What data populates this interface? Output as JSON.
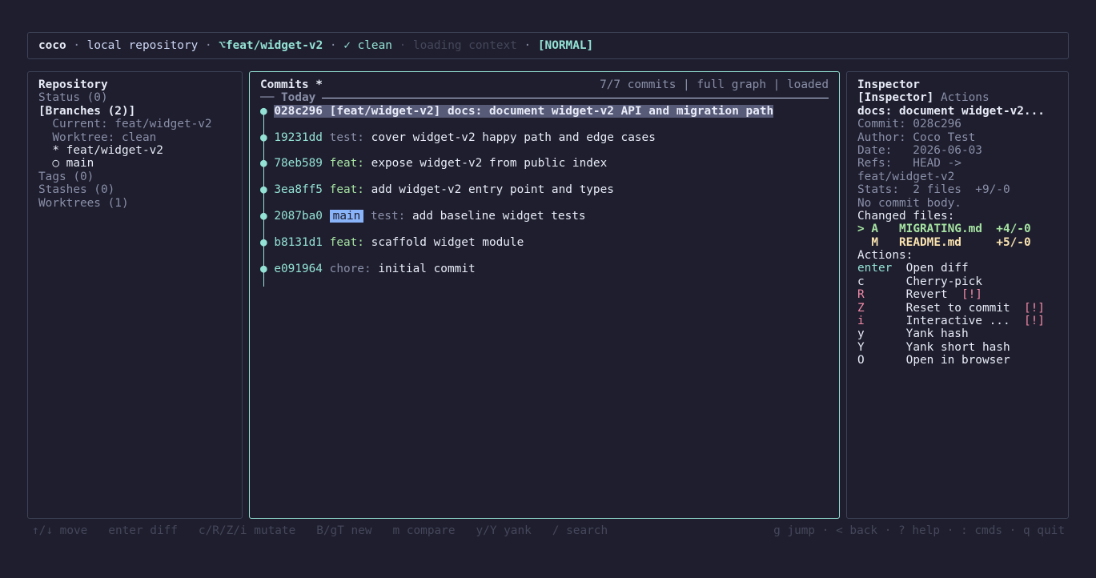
{
  "statusbar": {
    "app": "coco",
    "repo": "local repository",
    "branch": "⌥feat/widget-v2",
    "clean": "✓ clean",
    "loading": "loading context",
    "mode": "[NORMAL]"
  },
  "repo_panel": {
    "title": "Repository",
    "status": "Status (0)",
    "branches": "[Branches (2)]",
    "current": "  Current: feat/widget-v2",
    "worktree": "  Worktree: clean",
    "branch_items": [
      "  * feat/widget-v2",
      "  ○ main"
    ],
    "tags": "Tags (0)",
    "stashes": "Stashes (0)",
    "worktrees": "Worktrees (1)"
  },
  "commits_panel": {
    "title": "Commits *",
    "summary": "7/7 commits | full graph | loaded",
    "group": "── Today",
    "commits": [
      {
        "hash": "028c296",
        "refs": "[feat/widget-v2]",
        "type": "docs:",
        "msg": "document widget-v2 API and migration path"
      },
      {
        "hash": "19231dd",
        "type": "test:",
        "msg": "cover widget-v2 happy path and edge cases"
      },
      {
        "hash": "78eb589",
        "type": "feat:",
        "msg": "expose widget-v2 from public index"
      },
      {
        "hash": "3ea8ff5",
        "type": "feat:",
        "msg": "add widget-v2 entry point and types"
      },
      {
        "hash": "2087ba0",
        "badge": "main",
        "type": "test:",
        "msg": "add baseline widget tests"
      },
      {
        "hash": "b8131d1",
        "type": "feat:",
        "msg": "scaffold widget module"
      },
      {
        "hash": "e091964",
        "type": "chore:",
        "msg": "initial commit"
      }
    ]
  },
  "inspector": {
    "title": "Inspector",
    "tab_active": "[Inspector]",
    "tab_other": "Actions",
    "subject": "docs: document widget-v2...",
    "commit": "Commit: 028c296",
    "author": "Author: Coco Test",
    "date": "Date:   2026-06-03",
    "refs1": "Refs:   HEAD ->",
    "refs2": "feat/widget-v2",
    "stats": "Stats:  2 files  +9/-0",
    "body": "No commit body.",
    "changed_label": "Changed files:",
    "files": [
      {
        "prefix": "> A",
        "name": "MIGRATING.md",
        "delta": "+4/-0"
      },
      {
        "prefix": "  M",
        "name": "README.md",
        "delta": "+5/-0"
      }
    ],
    "actions_label": "Actions:",
    "actions": [
      {
        "key": "enter",
        "label": "Open diff",
        "warn": ""
      },
      {
        "key": "c",
        "label": "Cherry-pick",
        "warn": ""
      },
      {
        "key": "R",
        "label": "Revert",
        "warn": "[!]"
      },
      {
        "key": "Z",
        "label": "Reset to commit",
        "warn": "[!]"
      },
      {
        "key": "i",
        "label": "Interactive ...",
        "warn": "[!]"
      },
      {
        "key": "y",
        "label": "Yank hash",
        "warn": ""
      },
      {
        "key": "Y",
        "label": "Yank short hash",
        "warn": ""
      },
      {
        "key": "O",
        "label": "Open in browser",
        "warn": ""
      }
    ]
  },
  "footer": {
    "left": "↑/↓ move   enter diff   c/R/Z/i mutate   B/gT new   m compare   y/Y yank   / search",
    "right": "g jump · < back · ? help · : cmds · q quit"
  },
  "colors": {
    "background": "#1e1e2e",
    "accent": "#94e2d5",
    "selection": "#585b78",
    "badge": "#89b4fa",
    "feat": "#a6e3a1",
    "warn": "#f38ba8",
    "modified": "#f9e2af"
  }
}
